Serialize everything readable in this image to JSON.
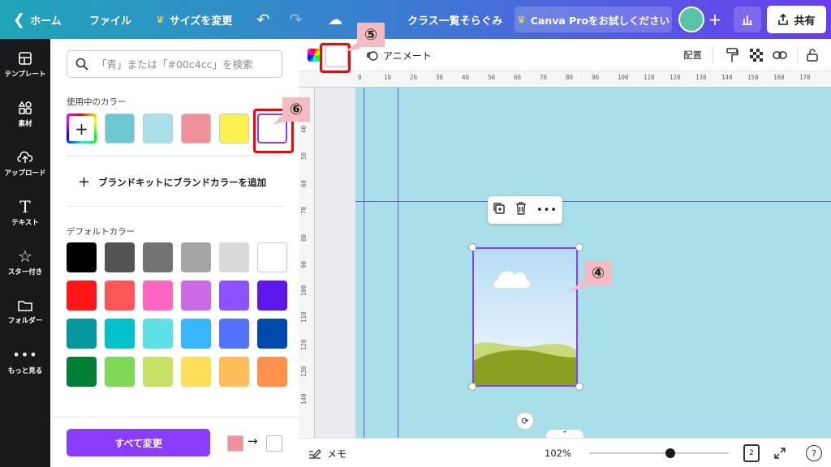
{
  "topbar": {
    "home": "ホーム",
    "file": "ファイル",
    "resize": "サイズを変更",
    "title": "クラス一覧そらぐみ",
    "pro": "Canva Proをお試しください",
    "share": "共有"
  },
  "rail": {
    "items": [
      {
        "label": "テンプレート",
        "icon": "template-icon"
      },
      {
        "label": "素材",
        "icon": "elements-icon"
      },
      {
        "label": "アップロード",
        "icon": "upload-icon"
      },
      {
        "label": "テキスト",
        "icon": "text-icon"
      },
      {
        "label": "スター付き",
        "icon": "star-icon"
      },
      {
        "label": "フォルダー",
        "icon": "folder-icon"
      },
      {
        "label": "もっと見る",
        "icon": "more-icon"
      }
    ]
  },
  "panel": {
    "search_placeholder": "「青」または「#00c4cc」を検索",
    "in_use_label": "使用中のカラー",
    "in_use_colors": [
      "#6cc8d3",
      "#a9dfe8",
      "#f0909a",
      "#fbf150",
      "#ffffff"
    ],
    "brand_add": "ブランドキットにブランドカラーを追加",
    "default_label": "デフォルトカラー",
    "default_colors": [
      [
        "#000000",
        "#545454",
        "#737373",
        "#a6a6a6",
        "#d9d9d9",
        "#ffffff"
      ],
      [
        "#ff1616",
        "#ff5757",
        "#ff66c4",
        "#cb6ce6",
        "#8c52ff",
        "#5e17eb"
      ],
      [
        "#03989e",
        "#00c2cb",
        "#5ce1e6",
        "#38b6ff",
        "#5271ff",
        "#004aad"
      ],
      [
        "#008037",
        "#7ed957",
        "#c9e265",
        "#ffde59",
        "#ffbd59",
        "#ff914d"
      ]
    ],
    "change_all": "すべて変更"
  },
  "toolbar": {
    "animate": "アニメート",
    "align": "配置"
  },
  "ruler": {
    "top": [
      "0",
      "10",
      "20",
      "30",
      "40",
      "50",
      "60",
      "70",
      "80",
      "90",
      "100",
      "110",
      "120",
      "130",
      "140",
      "150",
      "160",
      "170"
    ],
    "left": [
      "30",
      "40",
      "50",
      "60",
      "70",
      "80",
      "90",
      "100",
      "110",
      "120",
      "130",
      "140"
    ]
  },
  "bottom": {
    "memo": "メモ",
    "zoom": "102%",
    "zoom_fraction": 0.58,
    "pages": "2",
    "help": "?"
  },
  "annotations": {
    "m4": "④",
    "m5": "⑤",
    "m6": "⑥"
  },
  "colors": {
    "canvas_bg": "#a9dfe8",
    "accent": "#8b3dff"
  }
}
